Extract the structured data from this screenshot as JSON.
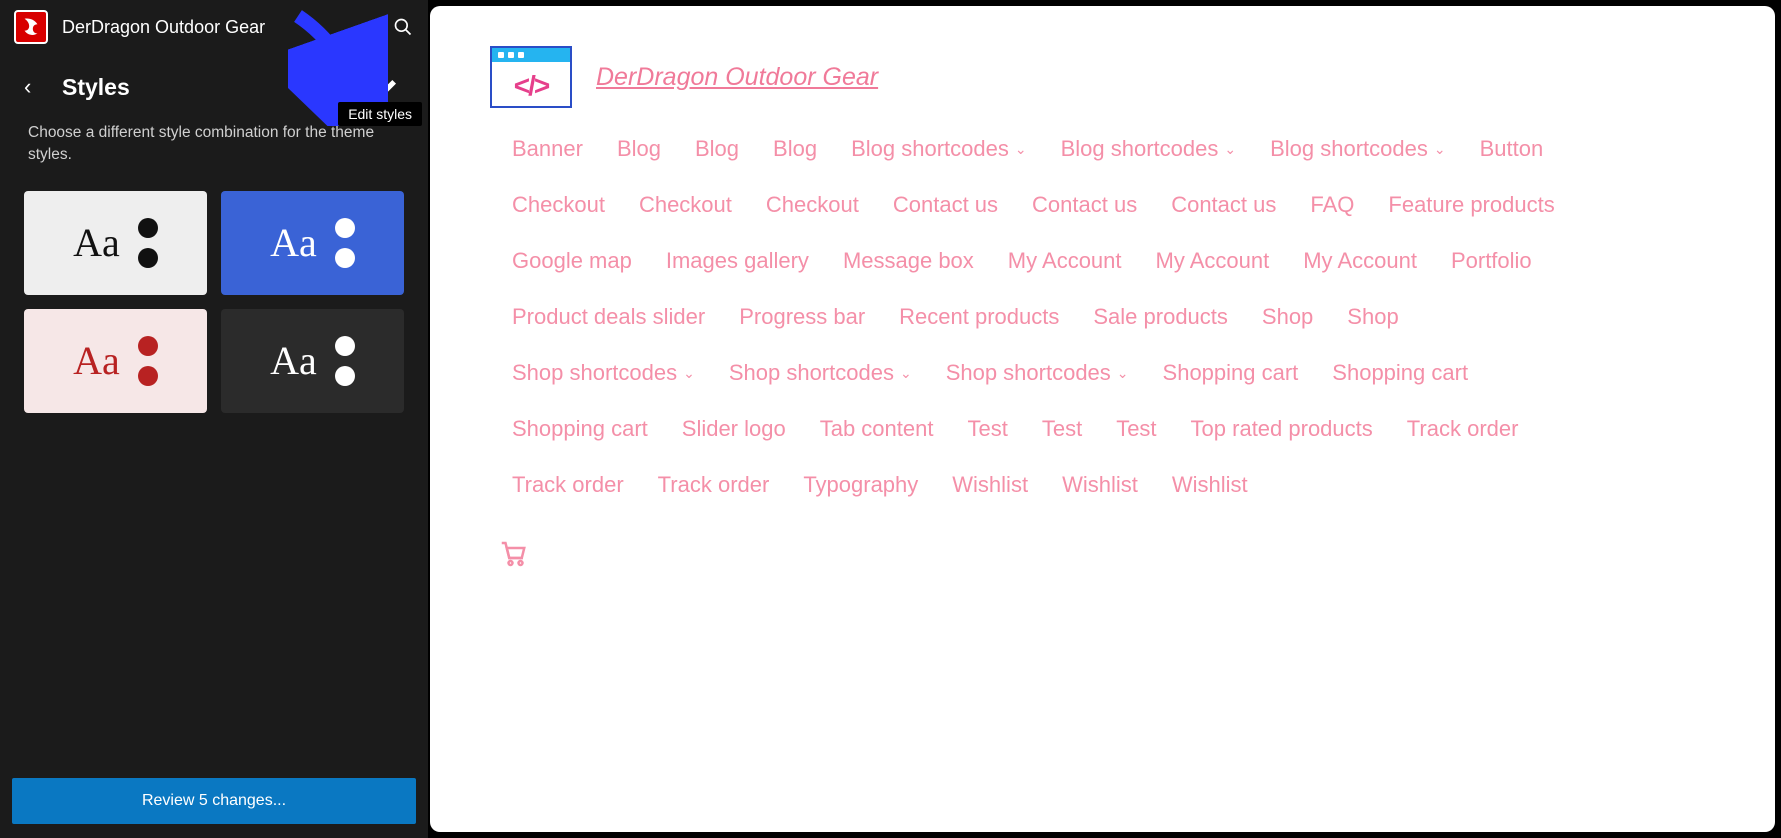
{
  "header": {
    "site_title": "DerDragon Outdoor Gear"
  },
  "styles_panel": {
    "title": "Styles",
    "tooltip": "Edit styles",
    "description": "Choose a different style combination for the theme styles.",
    "swatches": [
      {
        "bg": "light",
        "text": "Aa"
      },
      {
        "bg": "blue",
        "text": "Aa"
      },
      {
        "bg": "pink",
        "text": "Aa"
      },
      {
        "bg": "dark",
        "text": "Aa"
      }
    ],
    "review_button": "Review 5 changes..."
  },
  "preview": {
    "brand": "DerDragon Outdoor Gear",
    "nav": [
      {
        "label": "Banner",
        "dropdown": false
      },
      {
        "label": "Blog",
        "dropdown": false
      },
      {
        "label": "Blog",
        "dropdown": false
      },
      {
        "label": "Blog",
        "dropdown": false
      },
      {
        "label": "Blog shortcodes",
        "dropdown": true
      },
      {
        "label": "Blog shortcodes",
        "dropdown": true
      },
      {
        "label": "Blog shortcodes",
        "dropdown": true
      },
      {
        "label": "Button",
        "dropdown": false
      },
      {
        "label": "Checkout",
        "dropdown": false
      },
      {
        "label": "Checkout",
        "dropdown": false
      },
      {
        "label": "Checkout",
        "dropdown": false
      },
      {
        "label": "Contact us",
        "dropdown": false
      },
      {
        "label": "Contact us",
        "dropdown": false
      },
      {
        "label": "Contact us",
        "dropdown": false
      },
      {
        "label": "FAQ",
        "dropdown": false
      },
      {
        "label": "Feature products",
        "dropdown": false
      },
      {
        "label": "Google map",
        "dropdown": false
      },
      {
        "label": "Images gallery",
        "dropdown": false
      },
      {
        "label": "Message box",
        "dropdown": false
      },
      {
        "label": "My Account",
        "dropdown": false
      },
      {
        "label": "My Account",
        "dropdown": false
      },
      {
        "label": "My Account",
        "dropdown": false
      },
      {
        "label": "Portfolio",
        "dropdown": false
      },
      {
        "label": "Product deals slider",
        "dropdown": false
      },
      {
        "label": "Progress bar",
        "dropdown": false
      },
      {
        "label": "Recent products",
        "dropdown": false
      },
      {
        "label": "Sale products",
        "dropdown": false
      },
      {
        "label": "Shop",
        "dropdown": false
      },
      {
        "label": "Shop",
        "dropdown": false
      },
      {
        "label": "Shop shortcodes",
        "dropdown": true
      },
      {
        "label": "Shop shortcodes",
        "dropdown": true
      },
      {
        "label": "Shop shortcodes",
        "dropdown": true
      },
      {
        "label": "Shopping cart",
        "dropdown": false
      },
      {
        "label": "Shopping cart",
        "dropdown": false
      },
      {
        "label": "Shopping cart",
        "dropdown": false
      },
      {
        "label": "Slider logo",
        "dropdown": false
      },
      {
        "label": "Tab content",
        "dropdown": false
      },
      {
        "label": "Test",
        "dropdown": false
      },
      {
        "label": "Test",
        "dropdown": false
      },
      {
        "label": "Test",
        "dropdown": false
      },
      {
        "label": "Top rated products",
        "dropdown": false
      },
      {
        "label": "Track order",
        "dropdown": false
      },
      {
        "label": "Track order",
        "dropdown": false
      },
      {
        "label": "Track order",
        "dropdown": false
      },
      {
        "label": "Typography",
        "dropdown": false
      },
      {
        "label": "Wishlist",
        "dropdown": false
      },
      {
        "label": "Wishlist",
        "dropdown": false
      },
      {
        "label": "Wishlist",
        "dropdown": false
      }
    ]
  }
}
